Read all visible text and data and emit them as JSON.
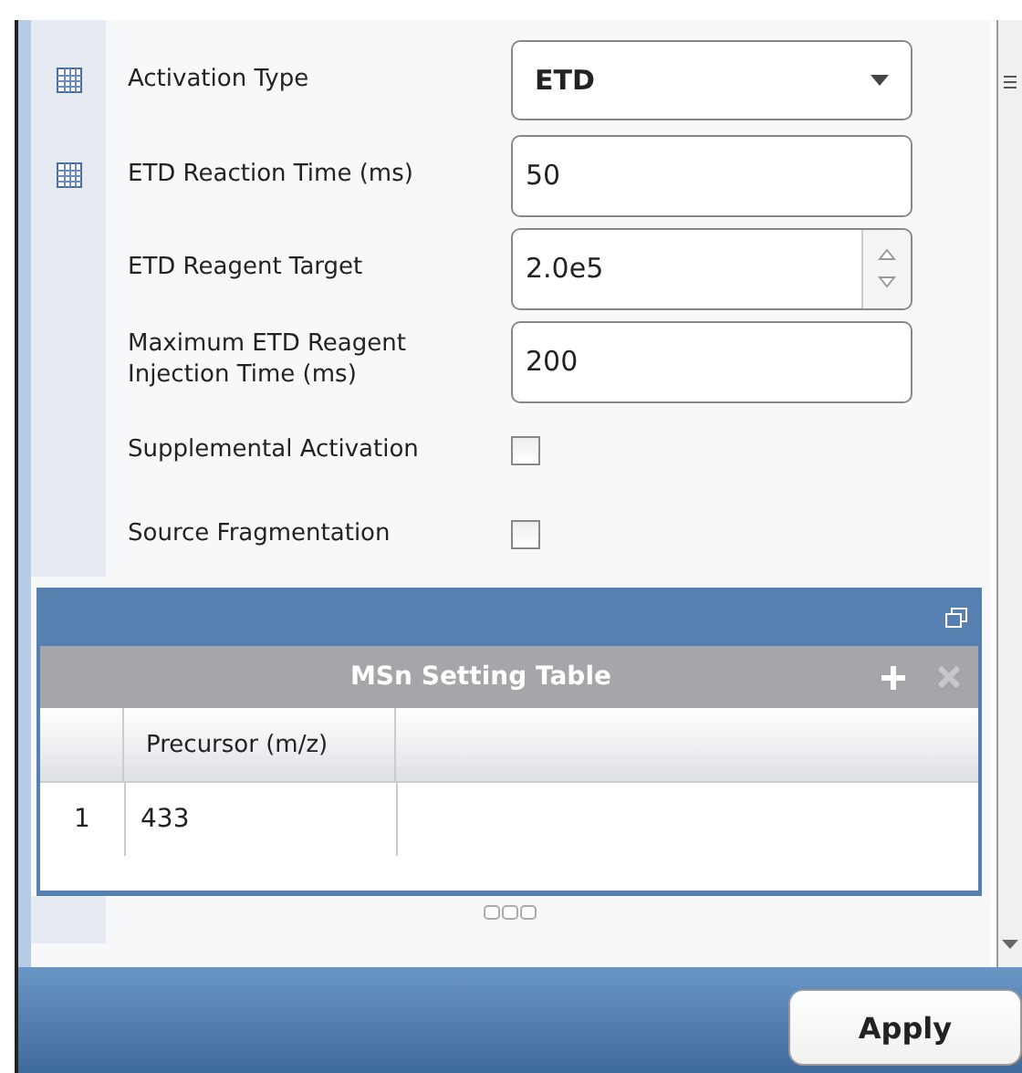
{
  "settings": [
    {
      "kind": "dropdown",
      "label": "Activation Type",
      "value": "ETD",
      "grid_icon": true
    },
    {
      "kind": "text",
      "label": "ETD Reaction Time (ms)",
      "value": "50",
      "grid_icon": true
    },
    {
      "kind": "spinner",
      "label": "ETD Reagent Target",
      "value": "2.0e5"
    },
    {
      "kind": "text",
      "label": "Maximum ETD Reagent Injection Time (ms)",
      "value": "200"
    },
    {
      "kind": "checkbox",
      "label": "Supplemental Activation",
      "checked": false
    },
    {
      "kind": "checkbox",
      "label": "Source Fragmentation",
      "checked": false
    }
  ],
  "table": {
    "title": "MSn Setting Table",
    "add_disabled": false,
    "remove_disabled": true,
    "columns": [
      "Precursor (m/z)"
    ],
    "rows": [
      {
        "number": "1",
        "cells": [
          "433"
        ]
      }
    ]
  },
  "apply_button": "Apply"
}
